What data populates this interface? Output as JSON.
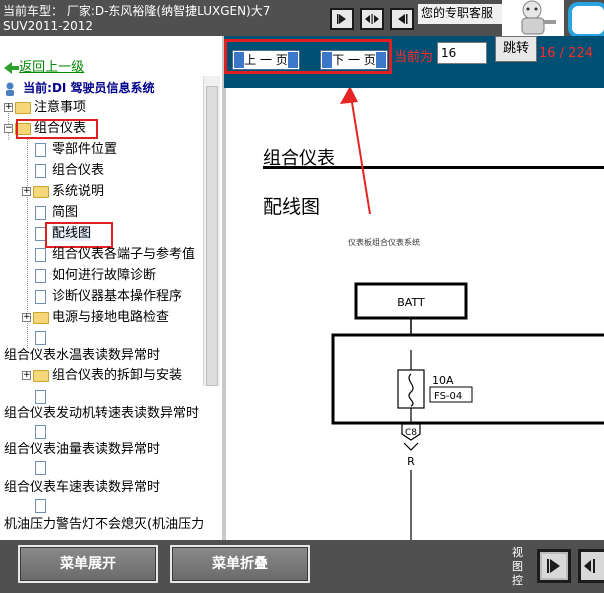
{
  "top_bar": {
    "title_line1": "当前车型：  厂家:D-东风裕隆(纳智捷LUXGEN)大7",
    "title_line2": "SUV2011-2012",
    "service_label": "您的专职客服"
  },
  "tree": {
    "back_link": "返回上一级",
    "current_system": "当前:DI 驾驶员信息系统",
    "items": [
      {
        "label": "注意事项",
        "type": "folder",
        "expander": "+"
      },
      {
        "label": "组合仪表",
        "type": "folder",
        "expander": "−"
      },
      {
        "label": "零部件位置",
        "type": "doc"
      },
      {
        "label": "组合仪表",
        "type": "doc"
      },
      {
        "label": "系统说明",
        "type": "folder",
        "expander": "+"
      },
      {
        "label": "简图",
        "type": "doc"
      },
      {
        "label": "配线图",
        "type": "doc",
        "selected": true
      },
      {
        "label": "组合仪表各端子与参考值",
        "type": "doc"
      },
      {
        "label": "如何进行故障诊断",
        "type": "doc"
      },
      {
        "label": "诊断仪器基本操作程序",
        "type": "doc"
      },
      {
        "label": "电源与接地电路检查",
        "type": "folder",
        "expander": "+"
      },
      {
        "label": "组合仪表水温表读数异常时",
        "type": "doc"
      },
      {
        "label": "组合仪表的拆卸与安装",
        "type": "folder",
        "expander": "+"
      },
      {
        "label": "组合仪表发动机转速表读数异常时",
        "type": "doc"
      },
      {
        "label": "组合仪表油量表读数异常时",
        "type": "doc"
      },
      {
        "label": "组合仪表车速表读数异常时",
        "type": "doc"
      },
      {
        "label": "机油压力警告灯不会熄灭(机油压力",
        "type": "doc"
      }
    ]
  },
  "pager": {
    "prev_label": "上 一 页",
    "next_label": "下 一 页",
    "current_label": "当前为",
    "page_value": "16",
    "jump_label": "跳转",
    "page_count": "16 / 224"
  },
  "document": {
    "section": "组合仪表",
    "title": "配线图",
    "caption": "仪表板组合仪表系统",
    "diagram": {
      "batt": "BATT",
      "fuse_amp": "10A",
      "fuse_id": "FS-04",
      "connector": "C8",
      "wire_color": "R"
    }
  },
  "bottom_bar": {
    "expand_label": "菜单展开",
    "collapse_label": "菜单折叠",
    "view_ctrl_label": "视图控"
  },
  "colors": {
    "top_bar": "#505050",
    "header_blue": "#005073",
    "highlight_red": "#e02020",
    "link_green": "#008800"
  }
}
